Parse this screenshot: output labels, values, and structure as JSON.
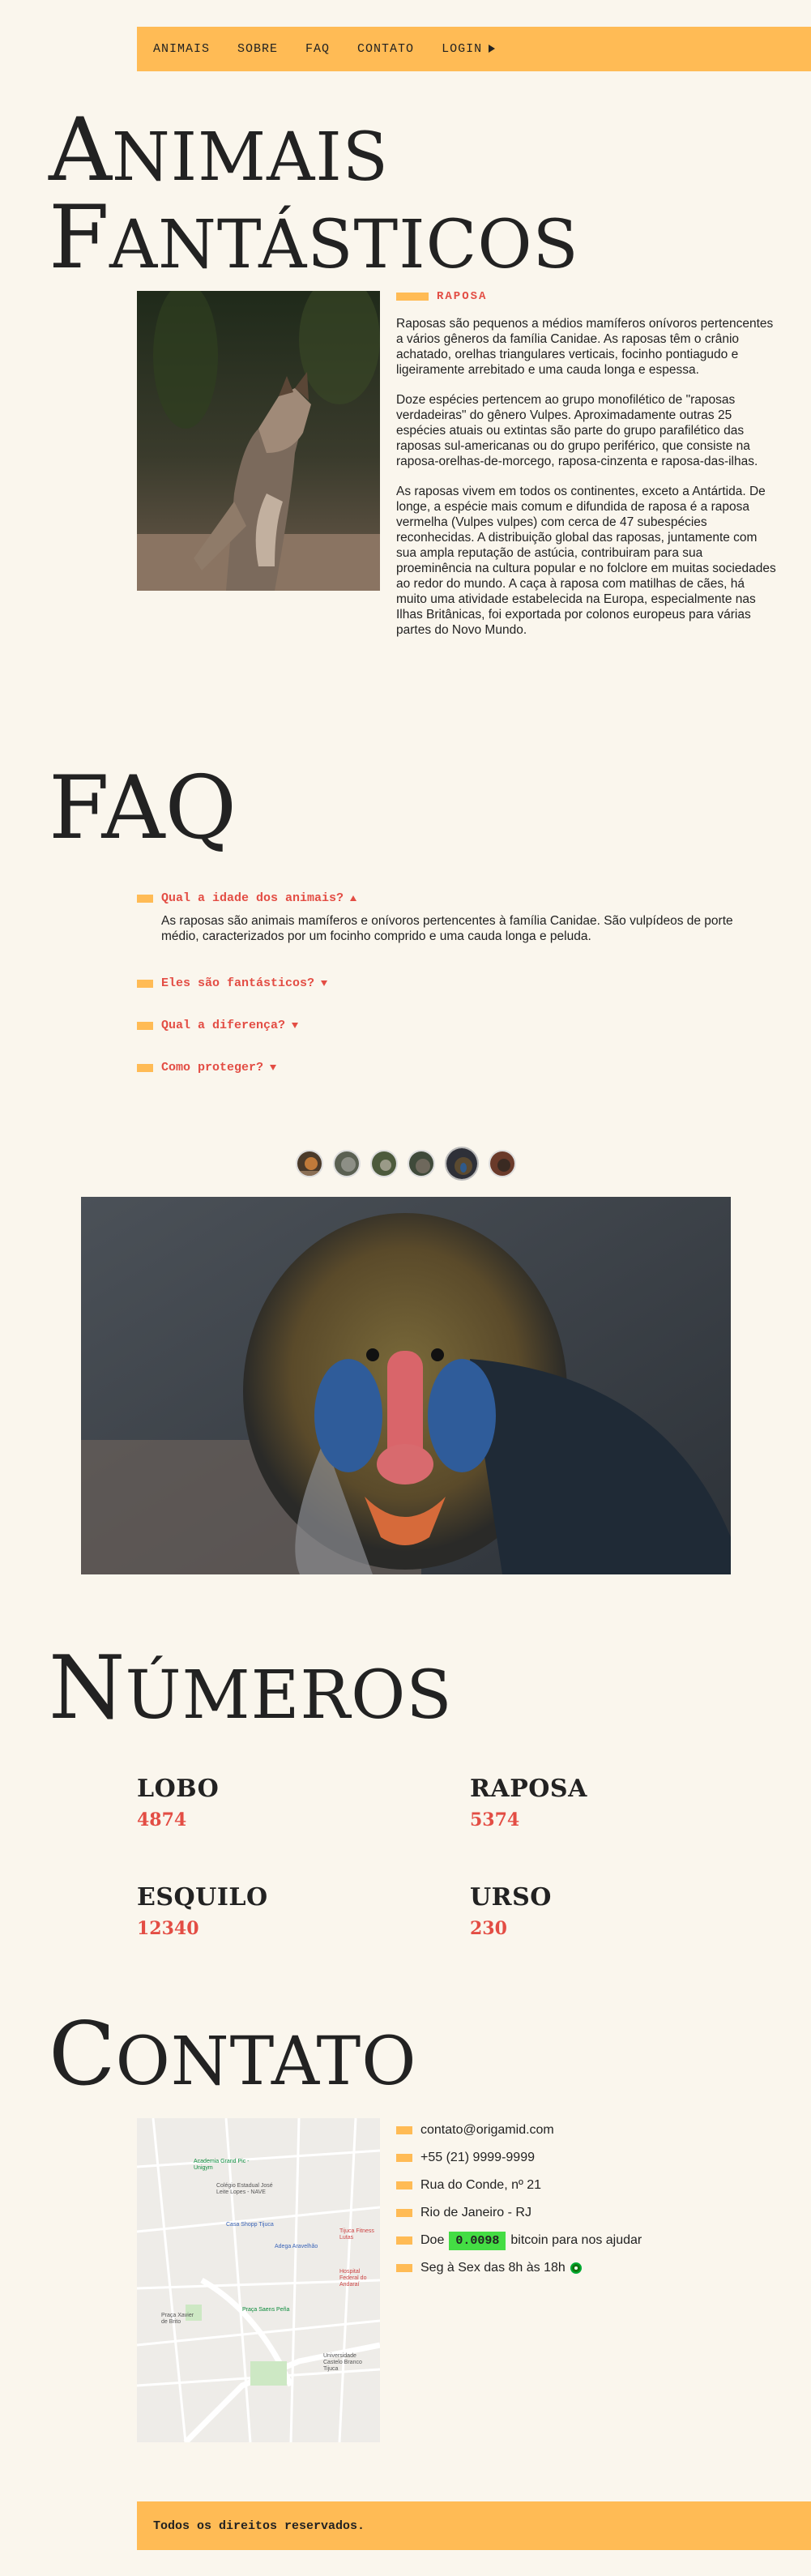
{
  "nav": {
    "items": [
      "ANIMAIS",
      "SOBRE",
      "FAQ",
      "CONTATO"
    ],
    "login": "LOGIN"
  },
  "animais": {
    "title_first": "A",
    "title_rest": "nimais",
    "title2_first": "F",
    "title2_rest": "antásticos",
    "label": "RAPOSA",
    "paragraphs": [
      "Raposas são pequenos a médios mamíferos onívoros pertencentes a vários gêneros da família Canidae. As raposas têm o crânio achatado, orelhas triangulares verticais, focinho pontiagudo e ligeiramente arrebitado e uma cauda longa e espessa.",
      "Doze espécies pertencem ao grupo monofilético de \"raposas verdadeiras\" do gênero Vulpes. Aproximadamente outras 25 espécies atuais ou extintas são parte do grupo parafilético das raposas sul-americanas ou do grupo periférico, que consiste na raposa-orelhas-de-morcego, raposa-cinzenta e raposa-das-ilhas.",
      "As raposas vivem em todos os continentes, exceto a Antártida. De longe, a espécie mais comum e difundida de raposa é a raposa vermelha (Vulpes vulpes) com cerca de 47 subespécies reconhecidas. A distribuição global das raposas, juntamente com sua ampla reputação de astúcia, contribuiram para sua proeminência na cultura popular e no folclore em muitas sociedades ao redor do mundo. A caça à raposa com matilhas de cães, há muito uma atividade estabelecida na Europa, especialmente nas Ilhas Britânicas, foi exportada por colonos europeus para várias partes do Novo Mundo."
    ]
  },
  "faq": {
    "title": "FAQ",
    "items": [
      {
        "q": "Qual a idade dos animais?",
        "a": "As raposas são animais mamíferos e onívoros pertencentes à família Canidae. São vulpídeos de porte médio, caracterizados por um focinho comprido e uma cauda longa e peluda.",
        "open": true
      },
      {
        "q": "Eles são fantásticos?",
        "open": false
      },
      {
        "q": "Qual a diferença?",
        "open": false
      },
      {
        "q": "Como proteger?",
        "open": false
      }
    ]
  },
  "numeros": {
    "title_first": "N",
    "title_rest": "úmeros",
    "items": [
      {
        "name": "LOBO",
        "value": "4874"
      },
      {
        "name": "RAPOSA",
        "value": "5374"
      },
      {
        "name": "ESQUILO",
        "value": "12340"
      },
      {
        "name": "URSO",
        "value": "230"
      }
    ]
  },
  "contato": {
    "title_first": "C",
    "title_rest": "ontato",
    "email": "contato@origamid.com",
    "phone": "+55 (21) 9999-9999",
    "address": "Rua do Conde, nº 21",
    "city": "Rio de Janeiro - RJ",
    "donate_pre": "Doe",
    "donate_amount": "0.0098",
    "donate_post": "bitcoin para nos ajudar",
    "hours": "Seg à Sex das 8h às 18h"
  },
  "map": {
    "labels": [
      "Academia Grand Pic - Unigym",
      "Colégio Estadual José Leite Lopes - NAVE",
      "Casa Shopp Tijuca",
      "Adega Aravelhão",
      "Tijuca Fitness Lutas",
      "Hospital Federal do Andaraí",
      "Praça Xavier de Brito",
      "Praça Saens Peña",
      "Universidade Castelo Branco Tijuca"
    ]
  },
  "footer": {
    "text": "Todos os direitos reservados."
  },
  "colors": {
    "accent": "#FFBB55",
    "highlight": "#E34D44",
    "background": "#FAF6ED",
    "bitcoin": "#44DD44"
  }
}
